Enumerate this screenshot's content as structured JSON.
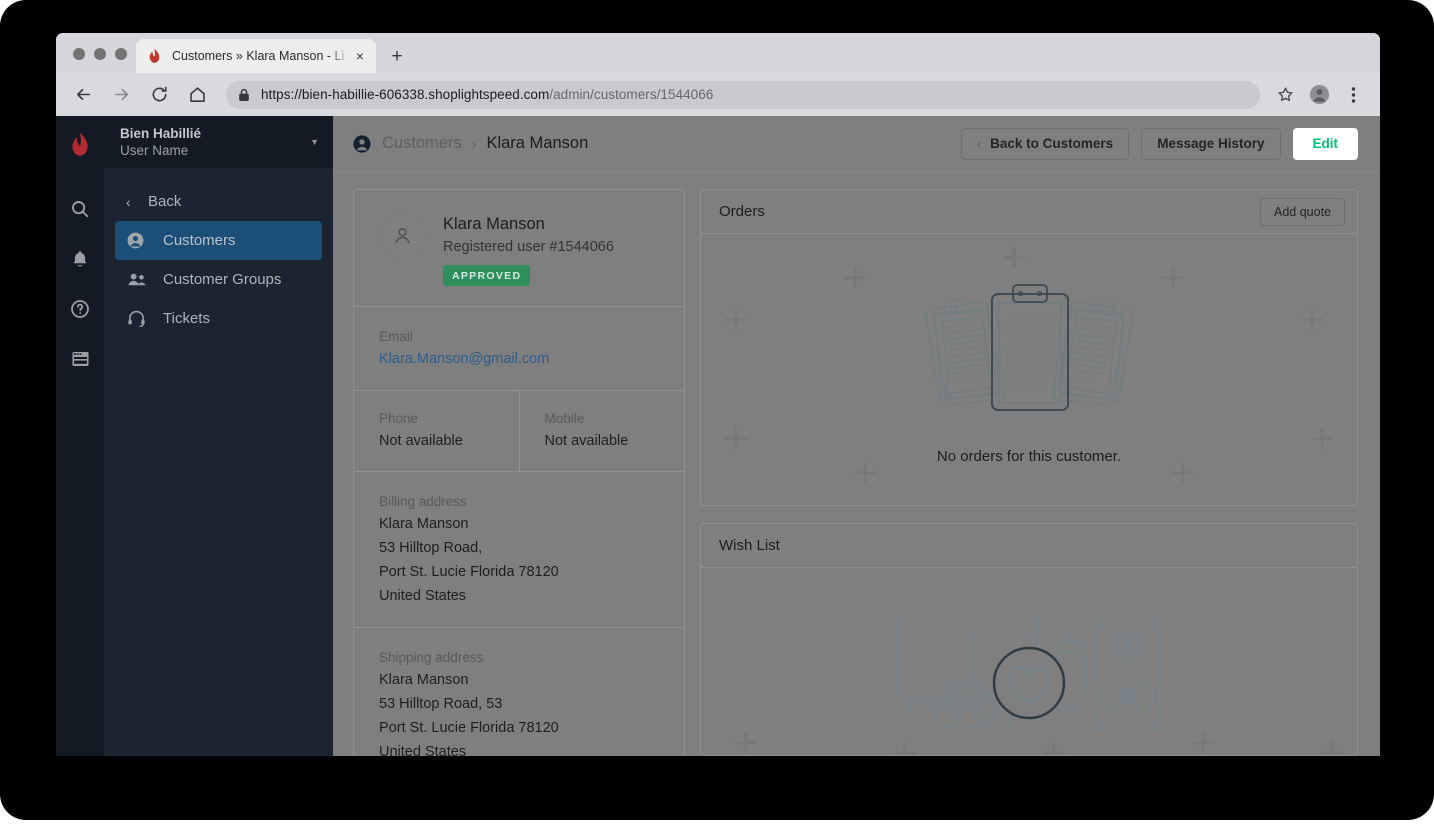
{
  "browser": {
    "tab": {
      "title": "Customers » Klara Manson - Li",
      "favicon": "lightspeed-flame-icon",
      "close": "×",
      "newtab": "+"
    },
    "nav": {
      "back": "back-arrow-icon",
      "forward": "forward-arrow-icon",
      "reload": "reload-icon",
      "home": "home-icon"
    },
    "omnibox": {
      "lock": "lock-icon",
      "url_secure": "https://bien-habillie-606338.shoplightspeed.com",
      "url_path": "/admin/customers/1544066"
    },
    "toolbar_right": {
      "bookmark": "star-icon",
      "profile": "profile-avatar-icon",
      "menu": "three-dot-menu-icon"
    }
  },
  "rail": {
    "logo": "lightspeed-flame-logo",
    "icons": [
      "search-icon",
      "bell-icon",
      "help-circle-icon",
      "browser-window-icon"
    ]
  },
  "sidebar": {
    "shop_name": "Bien Habillié",
    "user_name": "User Name",
    "caret": "▼",
    "back_label": "Back",
    "items": [
      {
        "label": "Customers",
        "icon": "user-circle-icon",
        "active": true
      },
      {
        "label": "Customer Groups",
        "icon": "users-group-icon",
        "active": false
      },
      {
        "label": "Tickets",
        "icon": "headset-icon",
        "active": false
      }
    ]
  },
  "topbar": {
    "breadcrumb_icon": "user-circle-icon",
    "breadcrumb_parent": "Customers",
    "breadcrumb_separator": "›",
    "breadcrumb_current": "Klara Manson",
    "back_to_customers": "Back to Customers",
    "back_caret": "‹",
    "message_history": "Message History",
    "edit": "Edit",
    "edit_color": "#00c16e"
  },
  "customer": {
    "avatar_icon": "person-avatar-icon",
    "name": "Klara Manson",
    "subtitle": "Registered user #1544066",
    "badge": "APPROVED",
    "badge_color": "#2e8f5c",
    "email_label": "Email",
    "email_value": "Klara.Manson@gmail.com",
    "phone_label": "Phone",
    "phone_value": "Not available",
    "mobile_label": "Mobile",
    "mobile_value": "Not available",
    "billing_label": "Billing address",
    "billing_lines": [
      "Klara Manson",
      "53 Hilltop Road,",
      "Port St. Lucie Florida 78120",
      "United States"
    ],
    "shipping_label": "Shipping address",
    "shipping_lines": [
      "Klara Manson",
      "53 Hilltop Road, 53",
      "Port St. Lucie Florida 78120",
      "United States"
    ]
  },
  "orders": {
    "title": "Orders",
    "add_quote": "Add quote",
    "empty_text": "No orders for this customer.",
    "empty_illustration": "clipboards-illustration"
  },
  "wishlist": {
    "title": "Wish List",
    "empty_illustration": "products-heart-illustration"
  }
}
